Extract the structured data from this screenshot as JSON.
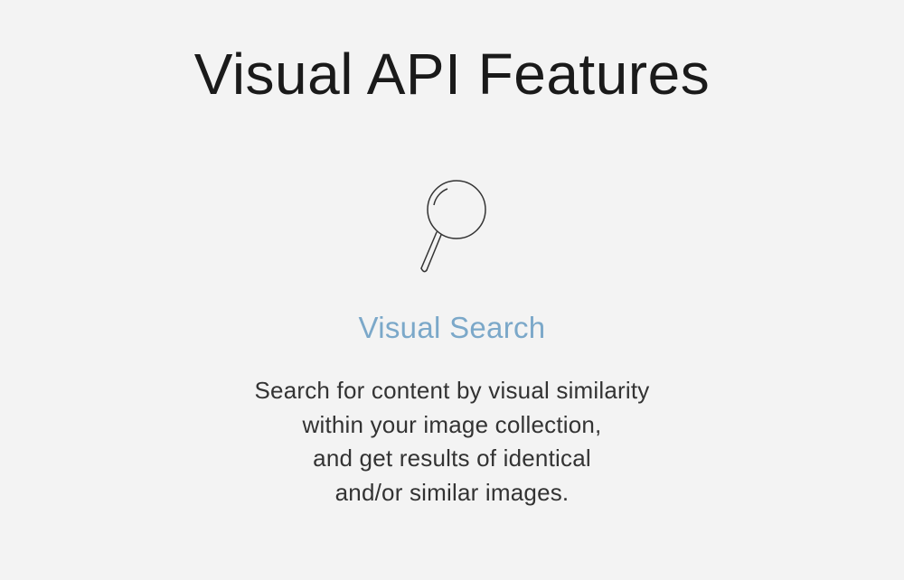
{
  "page": {
    "title": "Visual API Features"
  },
  "feature": {
    "icon_name": "magnifying-glass",
    "title": "Visual Search",
    "description_line1": "Search for content by visual similarity",
    "description_line2": "within your image collection,",
    "description_line3": "and get results of identical",
    "description_line4": "and/or similar images."
  },
  "colors": {
    "background": "#f3f3f3",
    "title_text": "#1a1a1a",
    "subtitle_text": "#7ba8c9",
    "body_text": "#333333"
  }
}
